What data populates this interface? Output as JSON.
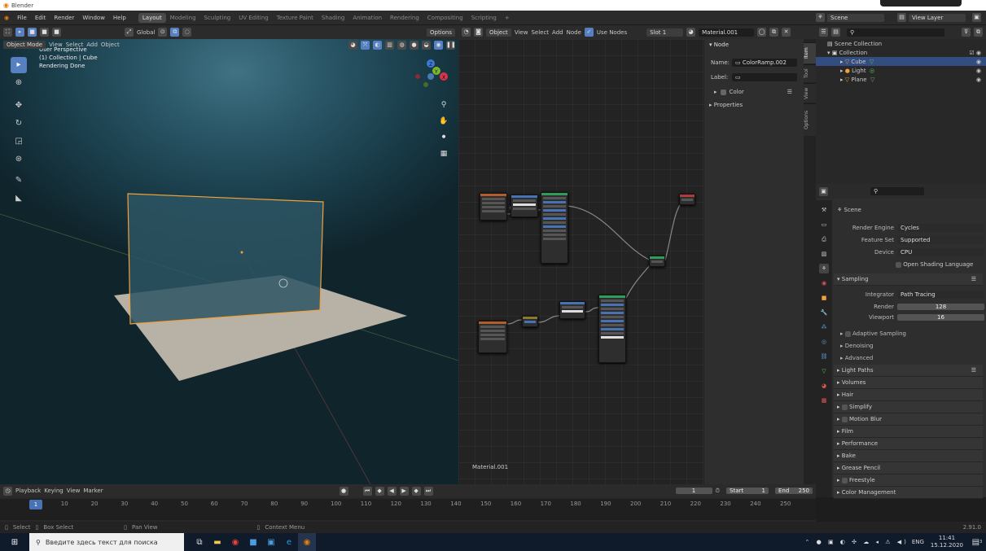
{
  "app": {
    "title": "Blender",
    "version": "2.91.0"
  },
  "menus": [
    "File",
    "Edit",
    "Render",
    "Window",
    "Help"
  ],
  "workspaces": [
    "Layout",
    "Modeling",
    "Sculpting",
    "UV Editing",
    "Texture Paint",
    "Shading",
    "Animation",
    "Rendering",
    "Compositing",
    "Scripting",
    "+"
  ],
  "top_right": {
    "scene": "Scene",
    "view_layer": "View Layer"
  },
  "viewport": {
    "mode": "Object Mode",
    "menus": [
      "View",
      "Select",
      "Add",
      "Object"
    ],
    "transform": "Global",
    "options": "Options",
    "info": [
      "User Perspective",
      "(1) Collection | Cube",
      "Rendering Done"
    ],
    "gizmo": {
      "x": "X",
      "y": "Y",
      "z": "Z"
    }
  },
  "node_editor": {
    "type": "Object",
    "menus": [
      "View",
      "Select",
      "Add",
      "Node"
    ],
    "use_nodes_label": "Use Nodes",
    "slot": "Slot 1",
    "material": "Material.001",
    "material_label": "Material.001"
  },
  "n_panel": {
    "section": "Node",
    "name_label": "Name:",
    "name_value": "ColorRamp.002",
    "label_label": "Label:",
    "color": "Color",
    "properties": "Properties",
    "tabs": [
      "Item",
      "Tool",
      "View",
      "Options"
    ]
  },
  "outliner": {
    "root": "Scene Collection",
    "collection": "Collection",
    "items": [
      {
        "name": "Cube",
        "color": "#e8a23a"
      },
      {
        "name": "Light",
        "color": "#e8a23a"
      },
      {
        "name": "Plane",
        "color": "#e8a23a"
      }
    ]
  },
  "properties": {
    "scene": "Scene",
    "render_engine_label": "Render Engine",
    "render_engine": "Cycles",
    "feature_set_label": "Feature Set",
    "feature_set": "Supported",
    "device_label": "Device",
    "device": "CPU",
    "osl": "Open Shading Language",
    "sampling": "Sampling",
    "integrator_label": "Integrator",
    "integrator": "Path Tracing",
    "render_label": "Render",
    "render_samples": "128",
    "viewport_label": "Viewport",
    "viewport_samples": "16",
    "subs": [
      "Adaptive Sampling",
      "Denoising",
      "Advanced"
    ],
    "sections": [
      "Light Paths",
      "Volumes",
      "Hair",
      "Simplify",
      "Motion Blur",
      "Film",
      "Performance",
      "Bake",
      "Grease Pencil",
      "Freestyle",
      "Color Management"
    ]
  },
  "timeline": {
    "menus": [
      "Playback",
      "Keying",
      "View",
      "Marker"
    ],
    "current": "1",
    "start_label": "Start",
    "start": "1",
    "end_label": "End",
    "end": "250",
    "ticks": [
      "1",
      "10",
      "20",
      "30",
      "40",
      "50",
      "60",
      "70",
      "80",
      "90",
      "100",
      "110",
      "120",
      "130",
      "140",
      "150",
      "160",
      "170",
      "180",
      "190",
      "200",
      "210",
      "220",
      "230",
      "240",
      "250"
    ]
  },
  "statusbar": {
    "select": "Select",
    "box_select": "Box Select",
    "pan_view": "Pan View",
    "context_menu": "Context Menu",
    "version": "2.91.0"
  },
  "taskbar": {
    "search_placeholder": "Введите здесь текст для поиска",
    "lang": "ENG",
    "time": "11:41",
    "date": "15.12.2020",
    "notif": "3"
  },
  "colors": {
    "accent": "#4772b3",
    "selection_orange": "#f5a13a",
    "active_row": "#334d80"
  }
}
